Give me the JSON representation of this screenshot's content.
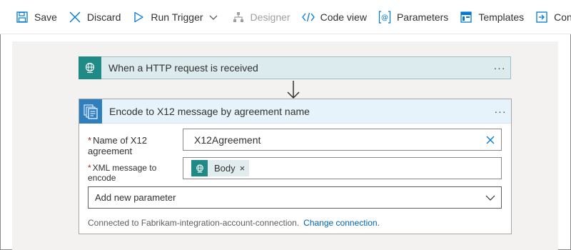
{
  "toolbar": {
    "save": "Save",
    "discard": "Discard",
    "run_trigger": "Run Trigger",
    "designer": "Designer",
    "code_view": "Code view",
    "parameters": "Parameters",
    "templates": "Templates",
    "connectors": "Connect"
  },
  "trigger_card": {
    "title": "When a HTTP request is received",
    "menu": "···",
    "icon": "http-globe-icon"
  },
  "action_card": {
    "title": "Encode to X12 message by agreement name",
    "menu": "···",
    "icon": "x12-document-icon",
    "fields": {
      "agreement_name": {
        "label_line1": "Name of X12",
        "label_line2": "agreement",
        "required_mark": "*",
        "value": "X12Agreement"
      },
      "xml_message": {
        "label_line1": "XML message to",
        "label_line2": "encode",
        "required_mark": "*",
        "token": "Body",
        "token_remove": "×"
      }
    },
    "add_parameter": "Add new parameter",
    "connection_text": "Connected to Fabrikam-integration-account-connection.",
    "change_connection": "Change connection."
  },
  "colors": {
    "accent_blue": "#0078d4",
    "trigger_teal": "#1f8a86",
    "action_blue": "#2f7fbf",
    "required_red": "#a4262c",
    "link_blue": "#0063b1"
  }
}
